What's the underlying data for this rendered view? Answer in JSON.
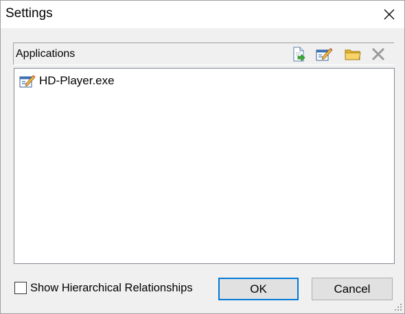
{
  "window": {
    "title": "Settings",
    "close_icon": "close-icon"
  },
  "applications": {
    "header": "Applications",
    "toolbar": [
      {
        "name": "add-application-icon"
      },
      {
        "name": "edit-application-icon"
      },
      {
        "name": "open-folder-icon"
      },
      {
        "name": "delete-icon"
      }
    ],
    "items": [
      {
        "label": "HD-Player.exe",
        "icon": "application-icon"
      }
    ]
  },
  "options": {
    "show_hierarchical_label": "Show Hierarchical Relationships",
    "show_hierarchical_checked": false
  },
  "buttons": {
    "ok_label": "OK",
    "cancel_label": "Cancel"
  },
  "colors": {
    "accent": "#0078d7",
    "dialog_bg": "#f0f0f0",
    "button_bg": "#e1e1e1"
  }
}
